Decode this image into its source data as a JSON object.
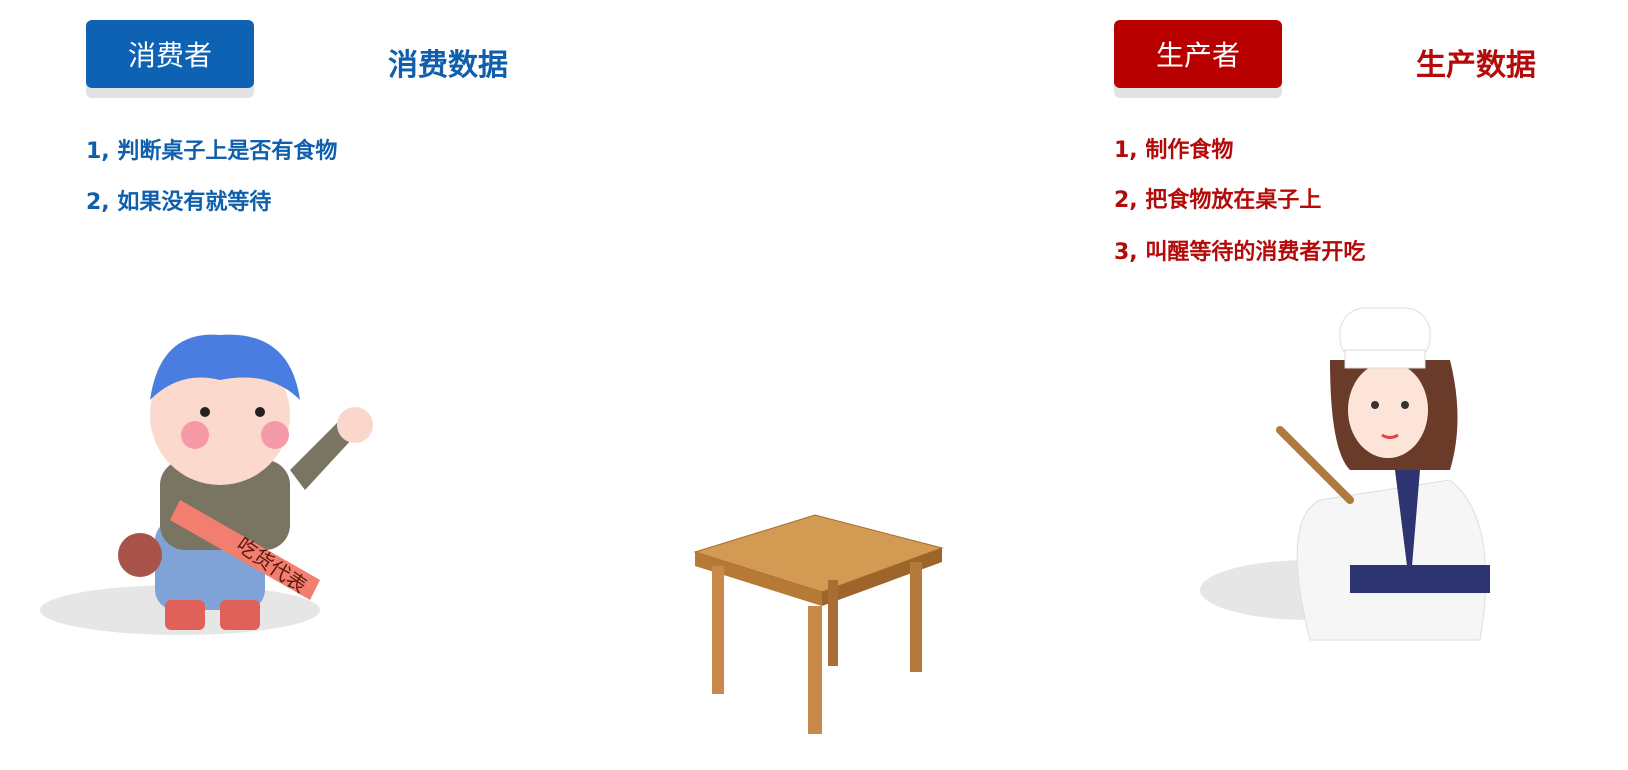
{
  "consumer": {
    "button_label": "消费者",
    "title": "消费数据",
    "steps": [
      "1,  判断桌子上是否有食物",
      "2,  如果没有就等待"
    ],
    "sash_text": "吃货代表"
  },
  "producer": {
    "button_label": "生产者",
    "title": "生产数据",
    "steps": [
      "1,  制作食物",
      "2,  把食物放在桌子上",
      "3,  叫醒等待的消费者开吃"
    ]
  },
  "colors": {
    "consumer": "#0e62b4",
    "producer": "#b80000"
  }
}
